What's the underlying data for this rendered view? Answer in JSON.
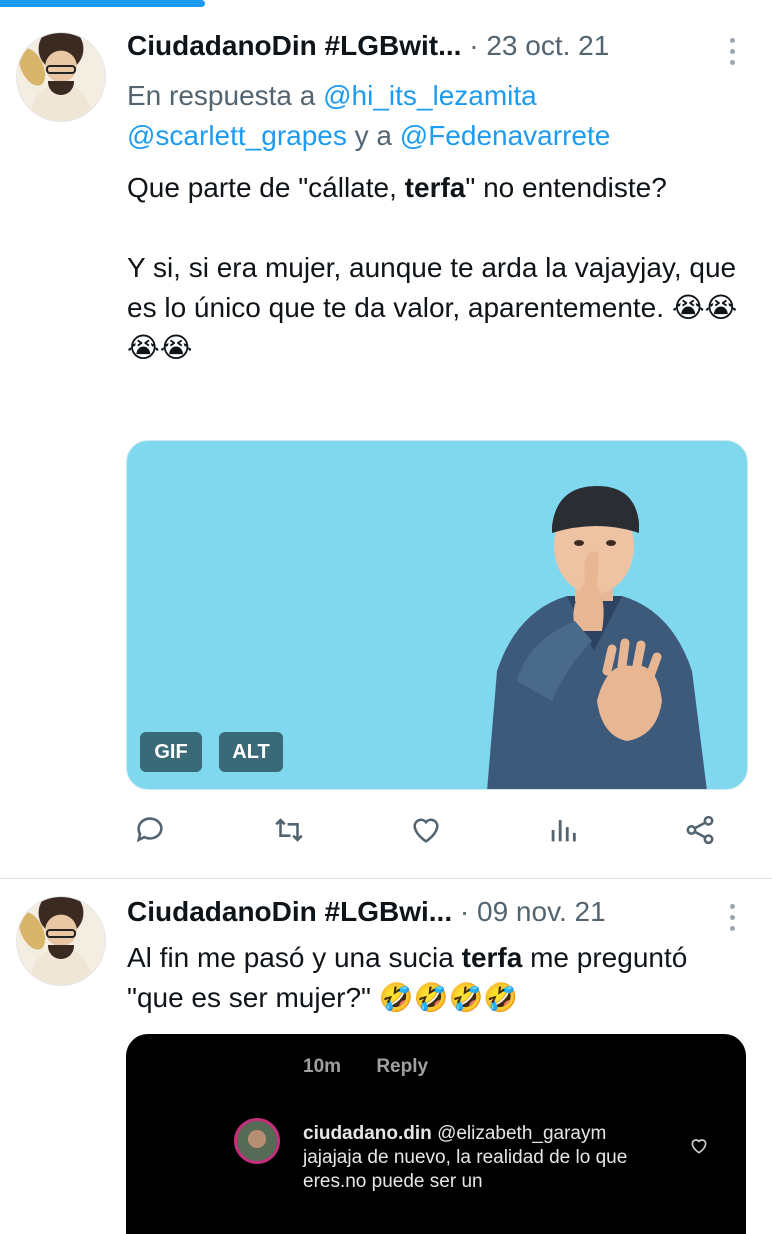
{
  "tweets": [
    {
      "name": "CiudadanoDin #LGBwit...",
      "date": "· 23 oct. 21",
      "reply_prefix": "En respuesta a",
      "reply_mention_1": "@hi_its_lezamita",
      "reply_mention_2": "@scarlett_grapes",
      "reply_and": "y a",
      "reply_mention_3": "@Fedenavarrete",
      "text_p1_before": "Que parte de \"cállate, ",
      "text_p1_bold": "terfa",
      "text_p1_after": "\" no entendiste?",
      "text_p2": "Y si, si era mujer, aunque te arda la vajayjay, que es lo único que te da valor, aparentemente.",
      "emojis": "😭😭😭😭",
      "media_badges": [
        "GIF",
        "ALT"
      ],
      "actions": [
        "reply-icon",
        "retweet-icon",
        "like-icon",
        "views-icon",
        "share-icon"
      ]
    },
    {
      "name": "CiudadanoDin #LGBwi...",
      "date": "· 09 nov. 21",
      "text_before": "Al fin me pasó y una sucia ",
      "text_bold": "terfa",
      "text_after": " me preguntó \"que es ser mujer?\"",
      "emojis": "🤣🤣🤣🤣",
      "embedded": {
        "time": "10m",
        "reply": "Reply",
        "username": "ciudadano.din",
        "mention": "@elizabeth_garaym",
        "comment": "jajajaja de nuevo, la realidad de lo que eres.no puede ser un"
      }
    }
  ],
  "colors": {
    "accent": "#1d9bf0",
    "secondary_text": "#536471",
    "media_bg": "#7fd8ee"
  }
}
